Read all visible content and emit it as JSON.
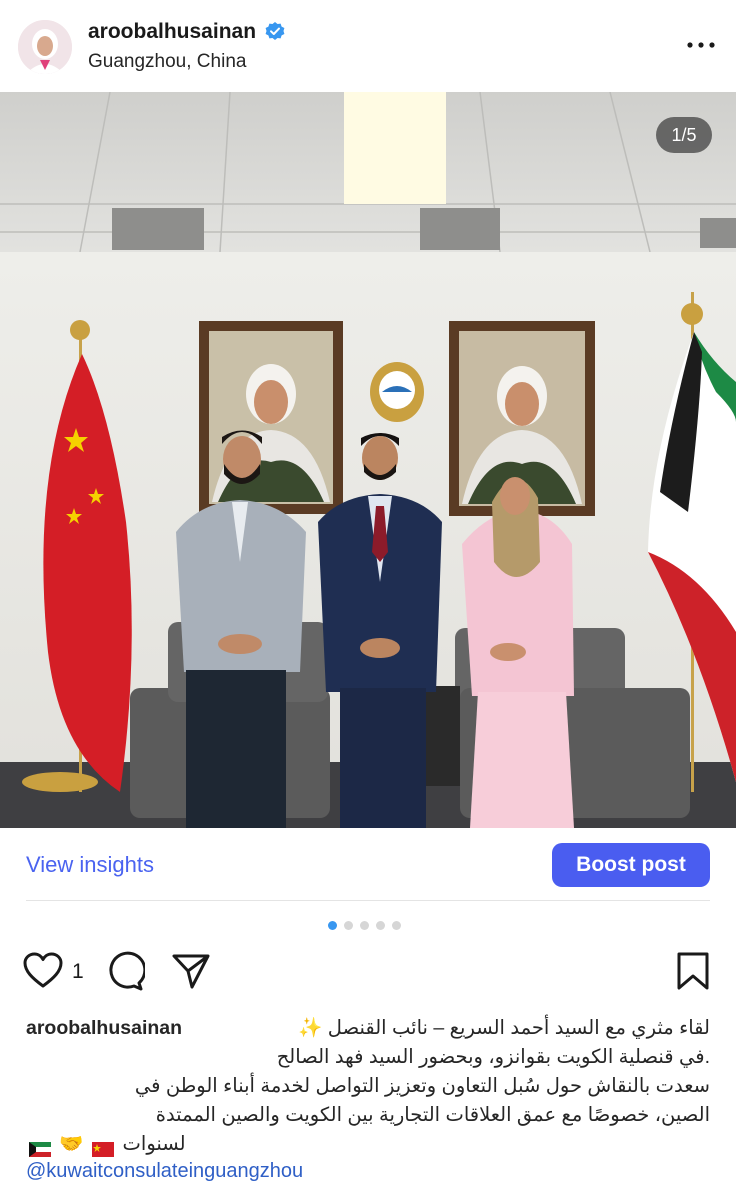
{
  "post": {
    "username": "aroobalhusainan",
    "location": "Guangzhou, China",
    "photo_counter": "1/5",
    "verified_icon": "verified-badge-icon",
    "more_icon": "more-options-icon"
  },
  "actions": {
    "view_insights": "View insights",
    "boost_post": "Boost post",
    "like_count": "1",
    "carousel_total": 5,
    "carousel_active_index": 1
  },
  "caption": {
    "username": "aroobalhusainan",
    "line1": "لقاء مثري مع السيد أحمد السريع – نائب القنصل ✨",
    "line2": ".في قنصلية الكويت بقوانزو، وبحضور السيد فهد الصالح",
    "line3": "سعدت بالنقاش حول سُبل التعاون وتعزيز التواصل لخدمة أبناء الوطن في",
    "line4": "الصين، خصوصًا مع عمق العلاقات التجارية بين الكويت والصين الممتدة",
    "line5": "لسنوات",
    "line5_emoji": "🤝",
    "mention": "@kuwaitconsulateinguangzhou"
  },
  "colors": {
    "link_blue": "#4a63f0",
    "boost_bg": "#4a5df0",
    "mention_blue": "#2f5fc6",
    "dot_active": "#3897f0"
  }
}
